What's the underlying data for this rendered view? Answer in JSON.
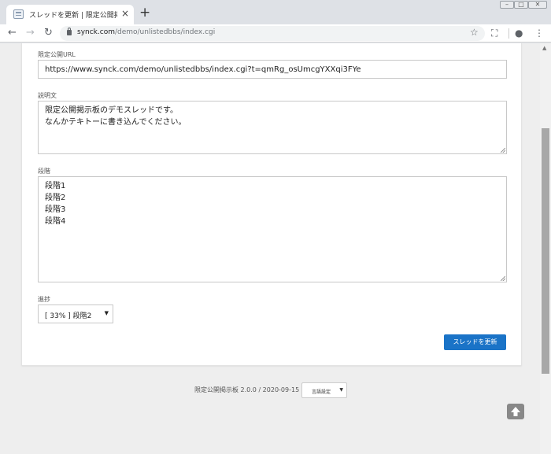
{
  "browser": {
    "tab_title": "スレッドを更新 | 限定公開掲示板",
    "tab_close": "×",
    "new_tab": "+",
    "url_host": "synck.com",
    "url_path": "/demo/unlistedbbs/index.cgi",
    "icons": [
      "back-icon",
      "forward-icon",
      "reload-icon",
      "lock-icon",
      "star-icon",
      "screenshot-icon",
      "profile-icon",
      "menu-icon"
    ]
  },
  "form": {
    "url_label": "限定公開URL",
    "url_value": "https://www.synck.com/demo/unlistedbbs/index.cgi?t=qmRg_osUmcgYXXqi3FYe",
    "desc_label": "説明文",
    "desc_line1": "限定公開掲示板のデモスレッドです。",
    "desc_line2": "なんかテキトーに書き込んでください。",
    "steps_label": "段階",
    "steps": [
      "段階1",
      "段階2",
      "段階3",
      "段階4"
    ],
    "progress_label": "進捗",
    "progress_selected": "[ 33% ] 段階2",
    "submit_label": "スレッドを更新"
  },
  "footer": {
    "text": "限定公開掲示板 2.0.0 / 2020-09-15",
    "lang_selected": "言語設定"
  },
  "colors": {
    "accent": "#1a73c7",
    "page_bg": "#eeeeee"
  }
}
